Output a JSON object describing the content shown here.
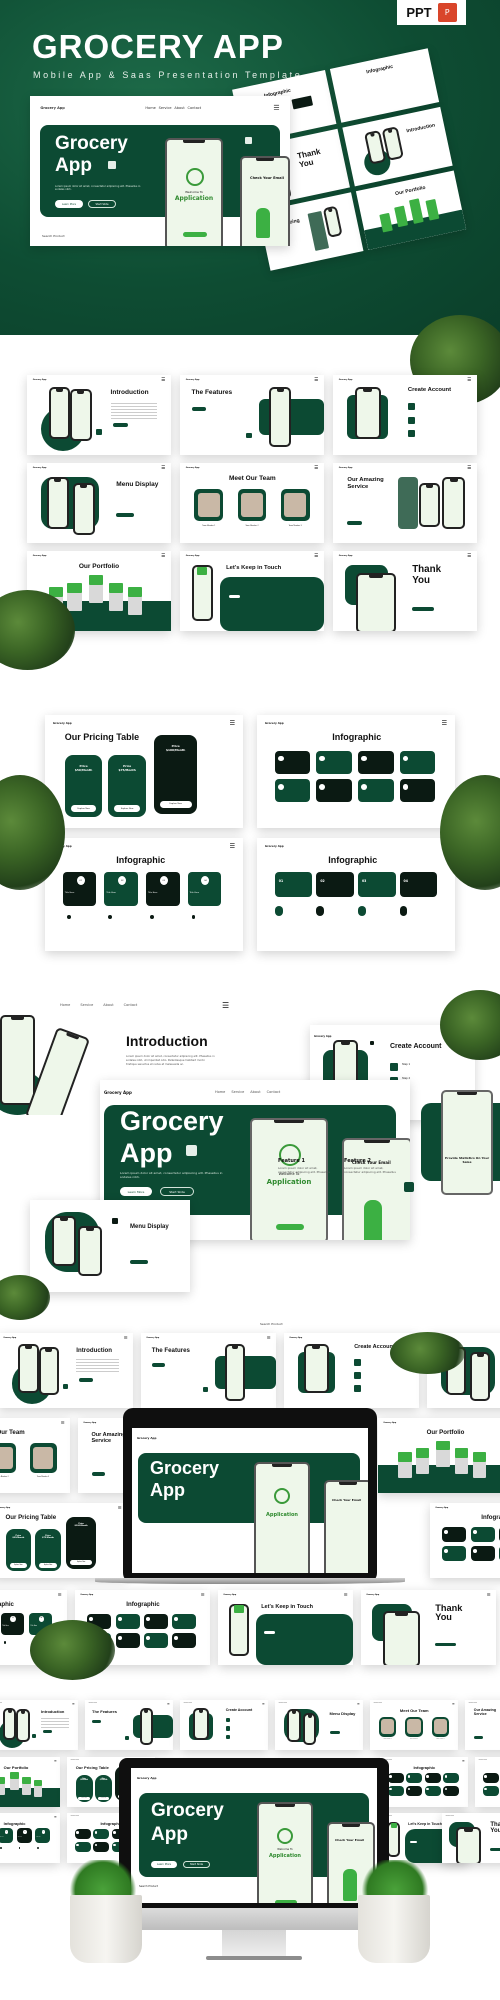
{
  "hero": {
    "title": "GROCERY APP",
    "subtitle": "Mobile App & Saas Presentation Template",
    "badge": {
      "label": "PPT",
      "icon": "powerpoint-icon"
    }
  },
  "colors": {
    "primary": "#0c4a33",
    "dark": "#0b1a13",
    "accent": "#3cb043",
    "light_bg": "#eef7ea",
    "badge_red": "#d9452a"
  },
  "nav": {
    "brand": "Grocery App",
    "links": [
      "Home",
      "Service",
      "About",
      "Contact"
    ],
    "menu_icon": "hamburger-menu-icon"
  },
  "cover_slide": {
    "title_line1": "Grocery",
    "title_line2": "App",
    "body": "Lorem ipsum dolor sit amet, consectetur adipiscing elit. Phasellus in sodales nibh.",
    "btn_primary": "Learn More",
    "btn_secondary": "Start Slide",
    "search": "Search Product",
    "phone1": {
      "welcome": "Welcome To",
      "title": "Application"
    },
    "phone2": {
      "title": "Check Your Email"
    }
  },
  "slides": {
    "introduction": {
      "title": "Introduction",
      "body": "Lorem ipsum dolor sit amet, consectetur adipiscing elit. Phasellus in sodales nibh, ut imperdiet odio. Pellentesque habitant morbi tristique senectus et netus et malesuada ac.",
      "phone_caption": "Welcome To Our Application"
    },
    "features": {
      "title": "The Features",
      "feature1": "Feature 1",
      "feature2": "Feature 2",
      "feature_body": "Lorem ipsum dolor sit amet, consectetur adipiscing elit. Phasellus",
      "phone_caption": "Provide Statistics On Your Sales"
    },
    "create_account": {
      "title": "Create Account",
      "steps": [
        "Step 1",
        "Step 2",
        "Step 3"
      ]
    },
    "menu_display": {
      "title": "Menu Display"
    },
    "team": {
      "title": "Meet Our Team",
      "members": [
        "Team Member 1",
        "Team Member 2",
        "Team Member 3"
      ]
    },
    "service": {
      "title_line1": "Our Amazing",
      "title_line2": "Service"
    },
    "portfolio": {
      "title": "Our Portfolio"
    },
    "contact": {
      "title": "Let's Keep in Touch"
    },
    "thanks": {
      "title_line1": "Thank",
      "title_line2": "You"
    },
    "pricing": {
      "title": "Our Pricing Table",
      "plans": [
        {
          "label": "Price",
          "price": "$50/Month",
          "cta": "Explore Now"
        },
        {
          "label": "Price",
          "price": "$75/Month",
          "cta": "Explore Now"
        },
        {
          "label": "Price",
          "price": "$100/Month",
          "cta": "Explore Now"
        }
      ]
    },
    "infographic": {
      "title": "Infographic",
      "item_title": "Title Here",
      "numbers": [
        "01",
        "02",
        "03",
        "04"
      ]
    }
  }
}
